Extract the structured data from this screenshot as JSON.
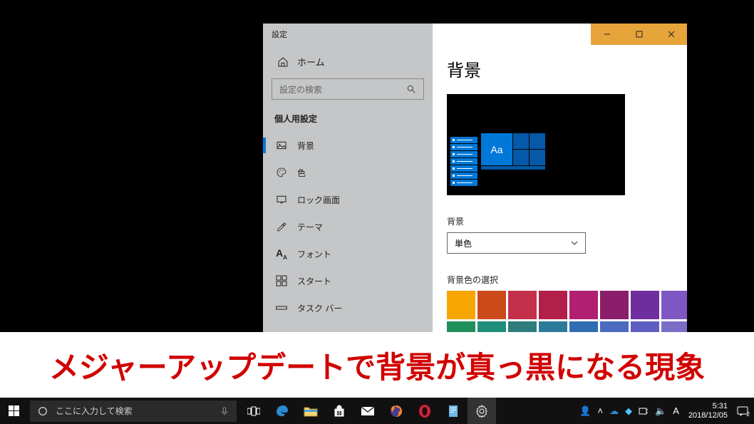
{
  "settings": {
    "window_title": "設定",
    "home_label": "ホーム",
    "search_placeholder": "設定の検索",
    "category_header": "個人用設定",
    "nav": [
      {
        "label": "背景",
        "icon": "picture-icon",
        "active": true
      },
      {
        "label": "色",
        "icon": "palette-icon",
        "active": false
      },
      {
        "label": "ロック画面",
        "icon": "lockscreen-icon",
        "active": false
      },
      {
        "label": "テーマ",
        "icon": "theme-icon",
        "active": false
      },
      {
        "label": "フォント",
        "icon": "font-icon",
        "active": false
      },
      {
        "label": "スタート",
        "icon": "start-icon",
        "active": false
      },
      {
        "label": "タスク バー",
        "icon": "taskbar-icon",
        "active": false
      }
    ],
    "page_title": "背景",
    "preview_tile_text": "Aa",
    "dropdown_label": "背景",
    "dropdown_value": "単色",
    "swatch_label": "背景色の選択",
    "swatches_row1": [
      "#f7a500",
      "#cc4a1a",
      "#c4304a",
      "#b21f49",
      "#b02070",
      "#8a1e6a",
      "#6e2e9e",
      "#7e57c2"
    ],
    "swatches_row2": [
      "#1f8f5b",
      "#1f8f7b",
      "#2e7c7c",
      "#2c7a99",
      "#2f6db3",
      "#4c6bc0",
      "#5e5ec2",
      "#7b6ec7"
    ],
    "swatches_row3": [
      "#6b6b4a",
      "#5b6b4a",
      "#4a6b4a",
      "#4a6b5b",
      "#4a6b6b",
      "#4a5b6b",
      "#4a4a6b",
      "#000000"
    ],
    "selected_swatch_index": 23
  },
  "caption": "メジャーアップデートで背景が真っ黒になる現象",
  "taskbar": {
    "search_placeholder": "ここに入力して検索",
    "apps": [
      {
        "name": "task-view-icon",
        "kind": "taskview"
      },
      {
        "name": "edge-icon",
        "kind": "edge"
      },
      {
        "name": "file-explorer-icon",
        "kind": "explorer"
      },
      {
        "name": "store-icon",
        "kind": "store"
      },
      {
        "name": "mail-icon",
        "kind": "mail"
      },
      {
        "name": "firefox-icon",
        "kind": "firefox"
      },
      {
        "name": "opera-icon",
        "kind": "opera"
      },
      {
        "name": "notes-icon",
        "kind": "notes"
      },
      {
        "name": "settings-icon",
        "kind": "settings",
        "active": true
      }
    ],
    "time": "5:31",
    "date": "2018/12/05",
    "notification_count": "2",
    "ime_label": "A"
  },
  "colors": {
    "accent": "#0078d7",
    "titlebar_buttons_bg": "#e6a43a"
  }
}
